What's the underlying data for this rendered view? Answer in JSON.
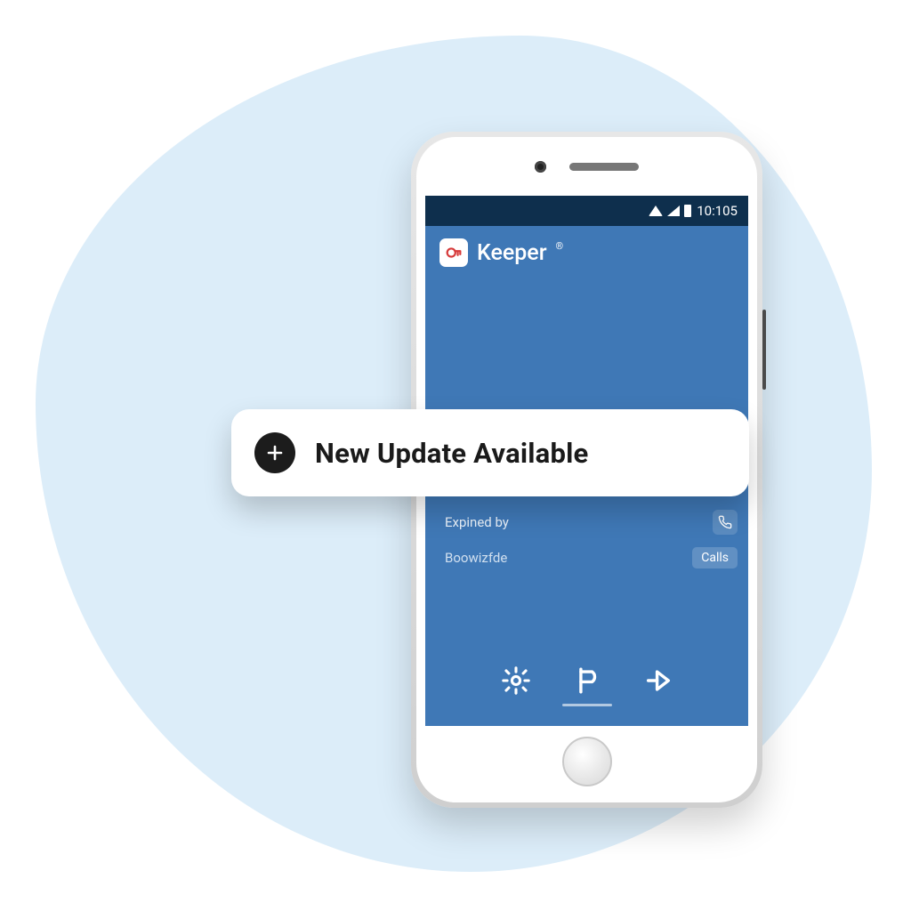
{
  "status_bar": {
    "time": "10:105"
  },
  "app": {
    "name": "Keeper",
    "trademark": "®"
  },
  "mid": {
    "row0": "",
    "row1_label": "Expined by",
    "row2_label": "Boowizfde",
    "calls_label": "Calls"
  },
  "banner": {
    "text": "New Update Available"
  }
}
